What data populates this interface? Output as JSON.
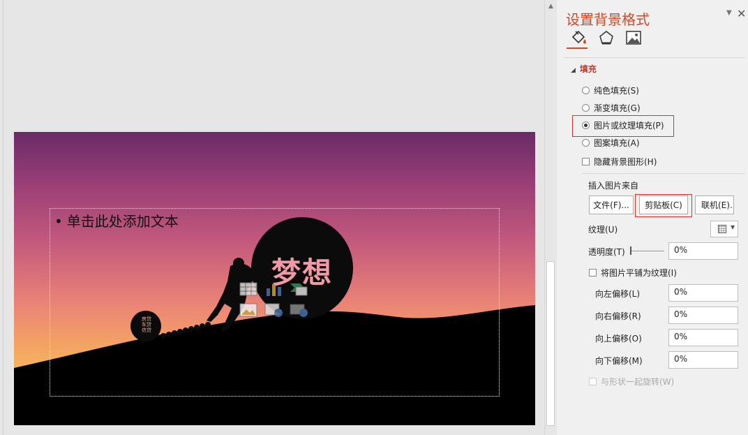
{
  "slide": {
    "placeholder_text": "单击此处添加文本",
    "bullet": "•",
    "ball_text": "梦想",
    "small_ball_text": [
      "房贷",
      "车贷",
      "信贷"
    ]
  },
  "pane": {
    "title": "设置背景格式",
    "tabs": [
      {
        "name": "fill",
        "icon": "paint-bucket-icon"
      },
      {
        "name": "effects",
        "icon": "pentagon-icon"
      },
      {
        "name": "picture",
        "icon": "picture-icon"
      }
    ],
    "section": "填充",
    "fill_options": [
      {
        "label": "纯色填充(S)",
        "selected": false
      },
      {
        "label": "渐变填充(G)",
        "selected": false
      },
      {
        "label": "图片或纹理填充(P)",
        "selected": true
      },
      {
        "label": "图案填充(A)",
        "selected": false
      }
    ],
    "hide_graphics": "隐藏背景图形(H)",
    "insert_from": "插入图片来自",
    "buttons": {
      "file": "文件(F)...",
      "clipboard": "剪贴板(C)",
      "online": "联机(E)..."
    },
    "texture_label": "纹理(U)",
    "transparency_label": "透明度(T)",
    "transparency_value": "0%",
    "tile_label": "将图片平铺为纹理(I)",
    "offsets": [
      {
        "label": "向左偏移(L)",
        "value": "0%"
      },
      {
        "label": "向右偏移(R)",
        "value": "0%"
      },
      {
        "label": "向上偏移(O)",
        "value": "0%"
      },
      {
        "label": "向下偏移(M)",
        "value": "0%"
      }
    ],
    "rotate_label": "与形状一起旋转(W)"
  },
  "colors": {
    "accent": "#d24726",
    "highlight": "#d9342b"
  }
}
